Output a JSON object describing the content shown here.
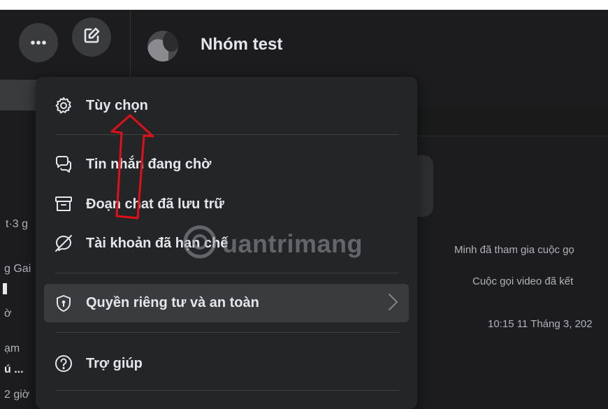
{
  "header": {
    "more_icon": "more-horizontal-icon",
    "compose_icon": "compose-icon",
    "group_name": "Nhóm test"
  },
  "background_left": {
    "fragments": [
      "t·3 g",
      "g Gai",
      "ờ",
      "ạm",
      "ú ...",
      "2 giờ"
    ]
  },
  "conversation": {
    "messages": [
      "Minh đã tham gia cuộc gọ",
      "Cuộc gọi video đã kết"
    ],
    "timestamp": "10:15 11 Tháng 3, 202"
  },
  "menu": {
    "items": [
      {
        "label": "Tùy chọn",
        "icon": "gear-icon"
      },
      {
        "label": "Tin nhắn đang chờ",
        "icon": "chat-bubbles-icon"
      },
      {
        "label": "Đoạn chat đã lưu trữ",
        "icon": "archive-box-icon"
      },
      {
        "label": "Tài khoản đã hạn chế",
        "icon": "restricted-chat-icon"
      },
      {
        "label": "Quyền riêng tư và an toàn",
        "icon": "shield-lock-icon"
      },
      {
        "label": "Trợ giúp",
        "icon": "help-circle-icon"
      }
    ]
  },
  "watermark": {
    "text": "uantrimang"
  },
  "colors": {
    "accent_arrow": "#e0101a",
    "menu_bg": "#242526",
    "page_bg": "#1c1c1e"
  }
}
